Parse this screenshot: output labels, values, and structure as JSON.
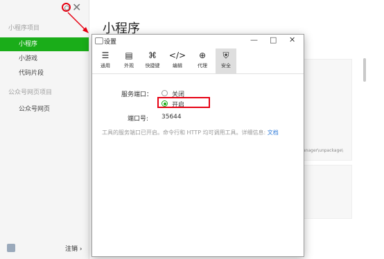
{
  "sidebar": {
    "section_miniprogram": "小程序项目",
    "items": [
      {
        "label": "小程序"
      },
      {
        "label": "小游戏"
      },
      {
        "label": "代码片段"
      }
    ],
    "section_web": "公众号网页项目",
    "web_item": "公众号网页",
    "logout": "注销 ›"
  },
  "main": {
    "title": "小程序",
    "path_snippet": "anager\\unpackage\\"
  },
  "dialog": {
    "title": "设置",
    "minimize": "—",
    "maximize": "□",
    "close": "✕",
    "tabs": [
      {
        "label": "通用",
        "icon": "general-icon"
      },
      {
        "label": "外观",
        "icon": "appearance-icon"
      },
      {
        "label": "快捷键",
        "icon": "shortcut-icon"
      },
      {
        "label": "编辑",
        "icon": "code-icon"
      },
      {
        "label": "代理",
        "icon": "globe-icon"
      },
      {
        "label": "安全",
        "icon": "shield-icon"
      }
    ],
    "service_port_label": "服务端口：",
    "option_off": "关闭",
    "option_on": "开启",
    "port_label": "端口号:",
    "port_value": "35644",
    "note_text": "工具的服务端口已开启。命令行和 HTTP 均可调用工具。详细信息: ",
    "note_link": "文档"
  },
  "colors": {
    "accent": "#1aad19",
    "highlight": "#e60012"
  }
}
